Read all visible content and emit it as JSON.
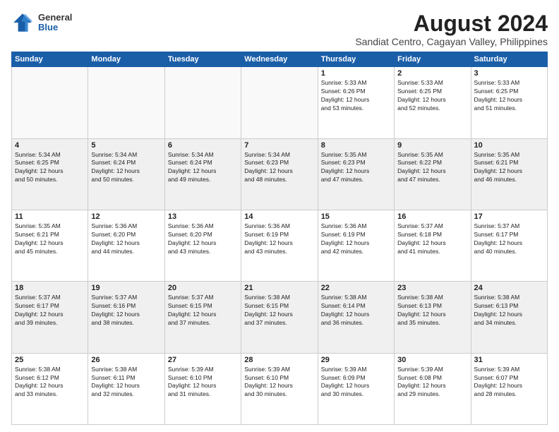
{
  "logo": {
    "general": "General",
    "blue": "Blue"
  },
  "title": "August 2024",
  "subtitle": "Sandiat Centro, Cagayan Valley, Philippines",
  "days_of_week": [
    "Sunday",
    "Monday",
    "Tuesday",
    "Wednesday",
    "Thursday",
    "Friday",
    "Saturday"
  ],
  "weeks": [
    [
      {
        "day": "",
        "info": ""
      },
      {
        "day": "",
        "info": ""
      },
      {
        "day": "",
        "info": ""
      },
      {
        "day": "",
        "info": ""
      },
      {
        "day": "1",
        "info": "Sunrise: 5:33 AM\nSunset: 6:26 PM\nDaylight: 12 hours\nand 53 minutes."
      },
      {
        "day": "2",
        "info": "Sunrise: 5:33 AM\nSunset: 6:25 PM\nDaylight: 12 hours\nand 52 minutes."
      },
      {
        "day": "3",
        "info": "Sunrise: 5:33 AM\nSunset: 6:25 PM\nDaylight: 12 hours\nand 51 minutes."
      }
    ],
    [
      {
        "day": "4",
        "info": "Sunrise: 5:34 AM\nSunset: 6:25 PM\nDaylight: 12 hours\nand 50 minutes."
      },
      {
        "day": "5",
        "info": "Sunrise: 5:34 AM\nSunset: 6:24 PM\nDaylight: 12 hours\nand 50 minutes."
      },
      {
        "day": "6",
        "info": "Sunrise: 5:34 AM\nSunset: 6:24 PM\nDaylight: 12 hours\nand 49 minutes."
      },
      {
        "day": "7",
        "info": "Sunrise: 5:34 AM\nSunset: 6:23 PM\nDaylight: 12 hours\nand 48 minutes."
      },
      {
        "day": "8",
        "info": "Sunrise: 5:35 AM\nSunset: 6:23 PM\nDaylight: 12 hours\nand 47 minutes."
      },
      {
        "day": "9",
        "info": "Sunrise: 5:35 AM\nSunset: 6:22 PM\nDaylight: 12 hours\nand 47 minutes."
      },
      {
        "day": "10",
        "info": "Sunrise: 5:35 AM\nSunset: 6:21 PM\nDaylight: 12 hours\nand 46 minutes."
      }
    ],
    [
      {
        "day": "11",
        "info": "Sunrise: 5:35 AM\nSunset: 6:21 PM\nDaylight: 12 hours\nand 45 minutes."
      },
      {
        "day": "12",
        "info": "Sunrise: 5:36 AM\nSunset: 6:20 PM\nDaylight: 12 hours\nand 44 minutes."
      },
      {
        "day": "13",
        "info": "Sunrise: 5:36 AM\nSunset: 6:20 PM\nDaylight: 12 hours\nand 43 minutes."
      },
      {
        "day": "14",
        "info": "Sunrise: 5:36 AM\nSunset: 6:19 PM\nDaylight: 12 hours\nand 43 minutes."
      },
      {
        "day": "15",
        "info": "Sunrise: 5:36 AM\nSunset: 6:19 PM\nDaylight: 12 hours\nand 42 minutes."
      },
      {
        "day": "16",
        "info": "Sunrise: 5:37 AM\nSunset: 6:18 PM\nDaylight: 12 hours\nand 41 minutes."
      },
      {
        "day": "17",
        "info": "Sunrise: 5:37 AM\nSunset: 6:17 PM\nDaylight: 12 hours\nand 40 minutes."
      }
    ],
    [
      {
        "day": "18",
        "info": "Sunrise: 5:37 AM\nSunset: 6:17 PM\nDaylight: 12 hours\nand 39 minutes."
      },
      {
        "day": "19",
        "info": "Sunrise: 5:37 AM\nSunset: 6:16 PM\nDaylight: 12 hours\nand 38 minutes."
      },
      {
        "day": "20",
        "info": "Sunrise: 5:37 AM\nSunset: 6:15 PM\nDaylight: 12 hours\nand 37 minutes."
      },
      {
        "day": "21",
        "info": "Sunrise: 5:38 AM\nSunset: 6:15 PM\nDaylight: 12 hours\nand 37 minutes."
      },
      {
        "day": "22",
        "info": "Sunrise: 5:38 AM\nSunset: 6:14 PM\nDaylight: 12 hours\nand 36 minutes."
      },
      {
        "day": "23",
        "info": "Sunrise: 5:38 AM\nSunset: 6:13 PM\nDaylight: 12 hours\nand 35 minutes."
      },
      {
        "day": "24",
        "info": "Sunrise: 5:38 AM\nSunset: 6:13 PM\nDaylight: 12 hours\nand 34 minutes."
      }
    ],
    [
      {
        "day": "25",
        "info": "Sunrise: 5:38 AM\nSunset: 6:12 PM\nDaylight: 12 hours\nand 33 minutes."
      },
      {
        "day": "26",
        "info": "Sunrise: 5:38 AM\nSunset: 6:11 PM\nDaylight: 12 hours\nand 32 minutes."
      },
      {
        "day": "27",
        "info": "Sunrise: 5:39 AM\nSunset: 6:10 PM\nDaylight: 12 hours\nand 31 minutes."
      },
      {
        "day": "28",
        "info": "Sunrise: 5:39 AM\nSunset: 6:10 PM\nDaylight: 12 hours\nand 30 minutes."
      },
      {
        "day": "29",
        "info": "Sunrise: 5:39 AM\nSunset: 6:09 PM\nDaylight: 12 hours\nand 30 minutes."
      },
      {
        "day": "30",
        "info": "Sunrise: 5:39 AM\nSunset: 6:08 PM\nDaylight: 12 hours\nand 29 minutes."
      },
      {
        "day": "31",
        "info": "Sunrise: 5:39 AM\nSunset: 6:07 PM\nDaylight: 12 hours\nand 28 minutes."
      }
    ]
  ]
}
